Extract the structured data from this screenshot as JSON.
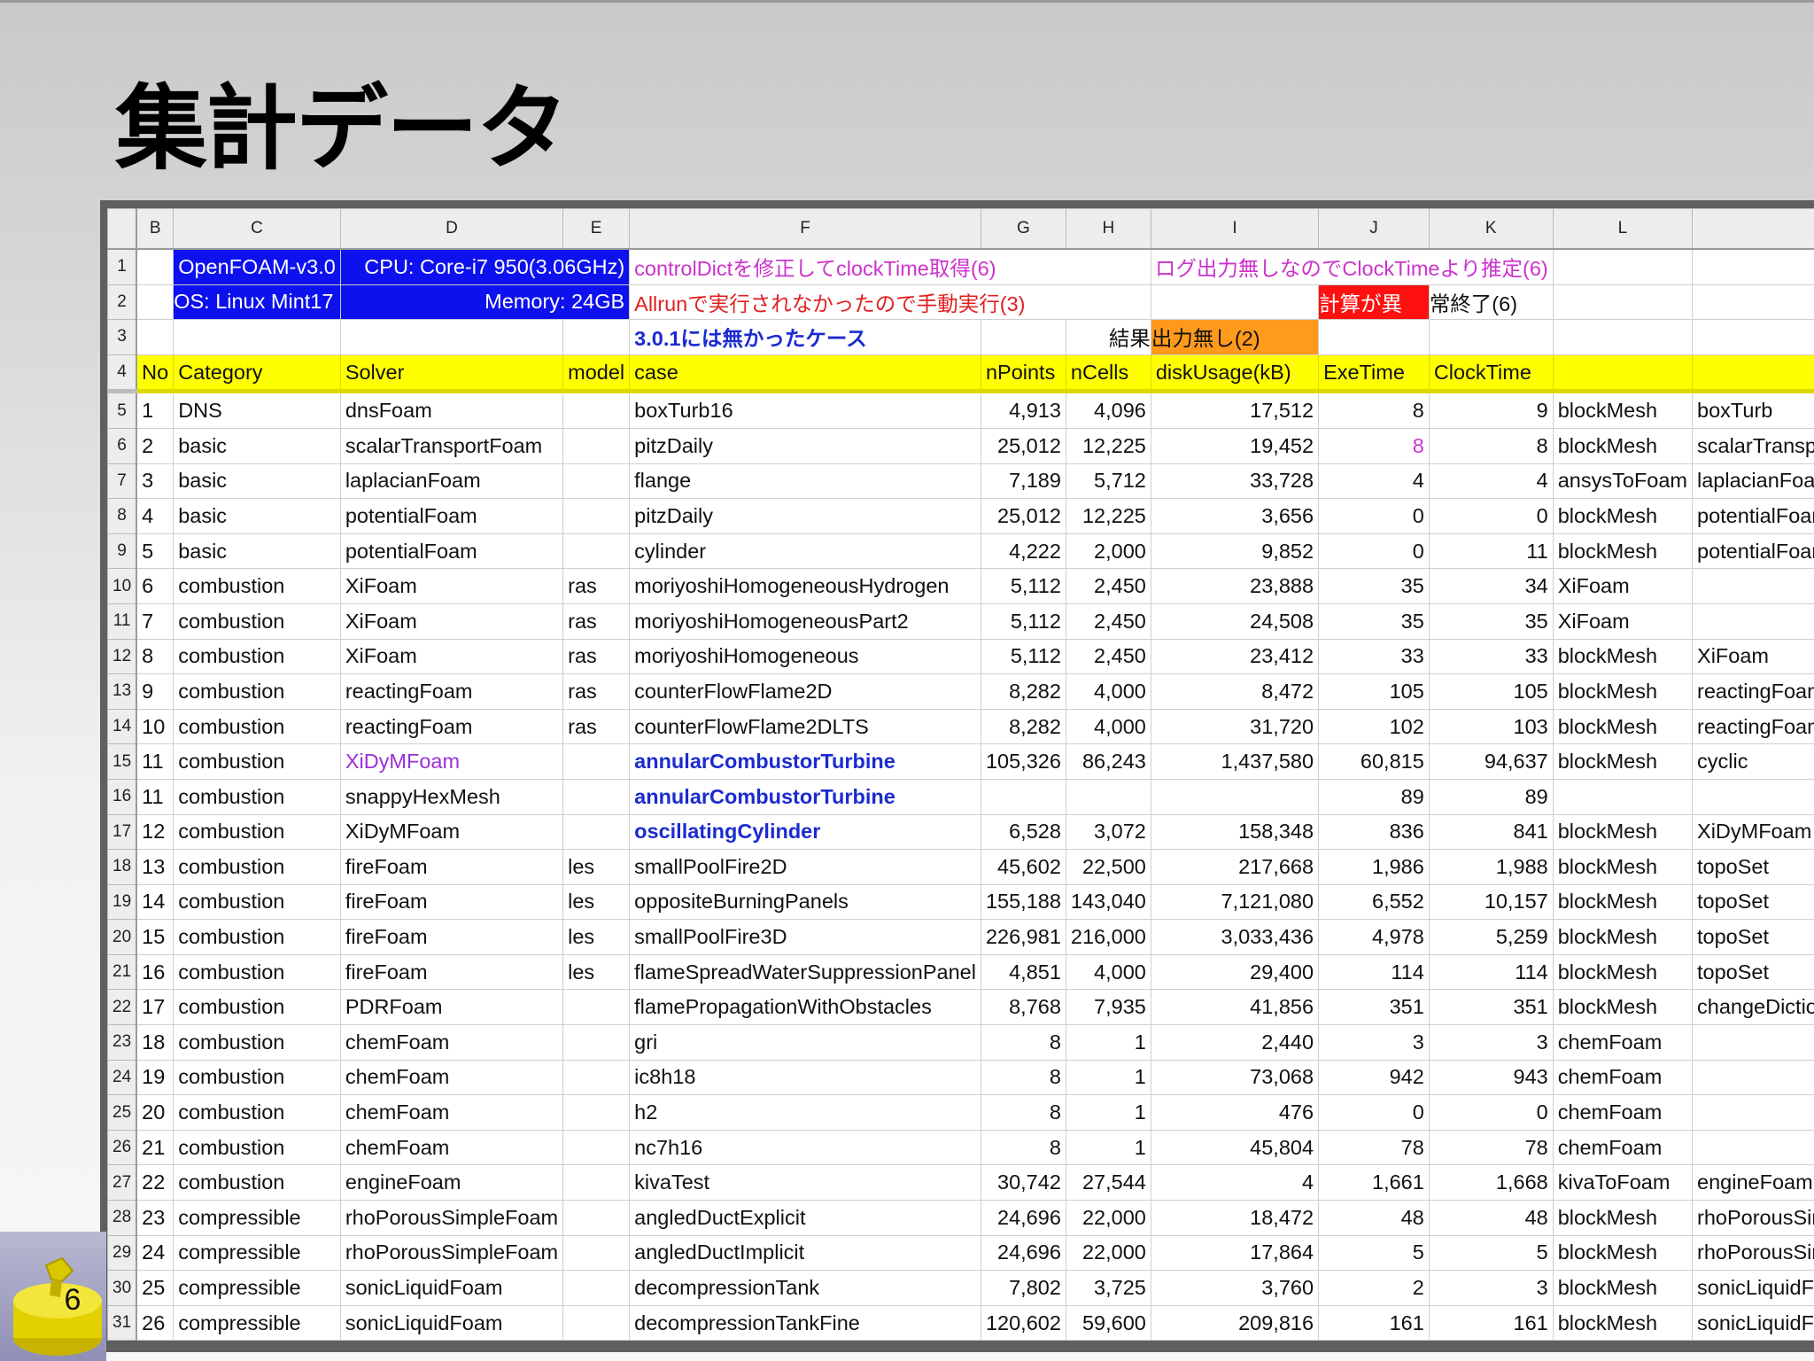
{
  "slide": {
    "title": "集計データ",
    "page_number": "6"
  },
  "column_headers": [
    "B",
    "C",
    "D",
    "E",
    "F",
    "G",
    "H",
    "I",
    "J",
    "K",
    "L",
    ""
  ],
  "top_rows": {
    "r1": {
      "rn": "1",
      "c": "OpenFOAM-v3.0",
      "de": "CPU: Core-i7 950(3.06GHz)",
      "f": "controlDictを修正してclockTime取得(6)",
      "ik": "ログ出力無しなのでClockTimeより推定(6)"
    },
    "r2": {
      "rn": "2",
      "c": "OS: Linux Mint17",
      "de": "Memory: 24GB",
      "f": "Allrunで実行されなかったので手動実行(3)",
      "j": "計算が異",
      "k": "常終了(6)"
    },
    "r3": {
      "rn": "3",
      "f": "3.0.1には無かったケース",
      "h": "結果",
      "i": "出力無し(2)"
    }
  },
  "header_row": {
    "rn": "4",
    "cells": [
      "No",
      "Category",
      "Solver",
      "model",
      "case",
      "nPoints",
      "nCells",
      "diskUsage(kB)",
      "ExeTime",
      "ClockTime",
      "",
      ""
    ]
  },
  "rows": [
    [
      "5",
      "1",
      "DNS",
      "dnsFoam",
      "",
      "boxTurb16",
      "4,913",
      "4,096",
      "17,512",
      "8",
      "9",
      "blockMesh",
      "boxTurb"
    ],
    [
      "6",
      "2",
      "basic",
      "scalarTransportFoam",
      "",
      "pitzDaily",
      "25,012",
      "12,225",
      "19,452",
      "8",
      "8",
      "blockMesh",
      "scalarTransportFoam"
    ],
    [
      "7",
      "3",
      "basic",
      "laplacianFoam",
      "",
      "flange",
      "7,189",
      "5,712",
      "33,728",
      "4",
      "4",
      "ansysToFoam",
      "laplacianFoam"
    ],
    [
      "8",
      "4",
      "basic",
      "potentialFoam",
      "",
      "pitzDaily",
      "25,012",
      "12,225",
      "3,656",
      "0",
      "0",
      "blockMesh",
      "potentialFoam"
    ],
    [
      "9",
      "5",
      "basic",
      "potentialFoam",
      "",
      "cylinder",
      "4,222",
      "2,000",
      "9,852",
      "0",
      "11",
      "blockMesh",
      "potentialFoam"
    ],
    [
      "10",
      "6",
      "combustion",
      "XiFoam",
      "ras",
      "moriyoshiHomogeneousHydrogen",
      "5,112",
      "2,450",
      "23,888",
      "35",
      "34",
      "XiFoam",
      ""
    ],
    [
      "11",
      "7",
      "combustion",
      "XiFoam",
      "ras",
      "moriyoshiHomogeneousPart2",
      "5,112",
      "2,450",
      "24,508",
      "35",
      "35",
      "XiFoam",
      ""
    ],
    [
      "12",
      "8",
      "combustion",
      "XiFoam",
      "ras",
      "moriyoshiHomogeneous",
      "5,112",
      "2,450",
      "23,412",
      "33",
      "33",
      "blockMesh",
      "XiFoam"
    ],
    [
      "13",
      "9",
      "combustion",
      "reactingFoam",
      "ras",
      "counterFlowFlame2D",
      "8,282",
      "4,000",
      "8,472",
      "105",
      "105",
      "blockMesh",
      "reactingFoam"
    ],
    [
      "14",
      "10",
      "combustion",
      "reactingFoam",
      "ras",
      "counterFlowFlame2DLTS",
      "8,282",
      "4,000",
      "31,720",
      "102",
      "103",
      "blockMesh",
      "reactingFoam"
    ],
    [
      "15",
      "11",
      "combustion",
      "XiDyMFoam",
      "",
      "annularCombustorTurbine",
      "105,326",
      "86,243",
      "1,437,580",
      "60,815",
      "94,637",
      "blockMesh",
      "cyclic"
    ],
    [
      "16",
      "11",
      "combustion",
      "snappyHexMesh",
      "",
      "annularCombustorTurbine",
      "",
      "",
      "",
      "89",
      "89",
      "",
      ""
    ],
    [
      "17",
      "12",
      "combustion",
      "XiDyMFoam",
      "",
      "oscillatingCylinder",
      "6,528",
      "3,072",
      "158,348",
      "836",
      "841",
      "blockMesh",
      "XiDyMFoam"
    ],
    [
      "18",
      "13",
      "combustion",
      "fireFoam",
      "les",
      "smallPoolFire2D",
      "45,602",
      "22,500",
      "217,668",
      "1,986",
      "1,988",
      "blockMesh",
      "topoSet"
    ],
    [
      "19",
      "14",
      "combustion",
      "fireFoam",
      "les",
      "oppositeBurningPanels",
      "155,188",
      "143,040",
      "7,121,080",
      "6,552",
      "10,157",
      "blockMesh",
      "topoSet"
    ],
    [
      "20",
      "15",
      "combustion",
      "fireFoam",
      "les",
      "smallPoolFire3D",
      "226,981",
      "216,000",
      "3,033,436",
      "4,978",
      "5,259",
      "blockMesh",
      "topoSet"
    ],
    [
      "21",
      "16",
      "combustion",
      "fireFoam",
      "les",
      "flameSpreadWaterSuppressionPanel",
      "4,851",
      "4,000",
      "29,400",
      "114",
      "114",
      "blockMesh",
      "topoSet"
    ],
    [
      "22",
      "17",
      "combustion",
      "PDRFoam",
      "",
      "flamePropagationWithObstacles",
      "8,768",
      "7,935",
      "41,856",
      "351",
      "351",
      "blockMesh",
      "changeDictionary"
    ],
    [
      "23",
      "18",
      "combustion",
      "chemFoam",
      "",
      "gri",
      "8",
      "1",
      "2,440",
      "3",
      "3",
      "chemFoam",
      ""
    ],
    [
      "24",
      "19",
      "combustion",
      "chemFoam",
      "",
      "ic8h18",
      "8",
      "1",
      "73,068",
      "942",
      "943",
      "chemFoam",
      ""
    ],
    [
      "25",
      "20",
      "combustion",
      "chemFoam",
      "",
      "h2",
      "8",
      "1",
      "476",
      "0",
      "0",
      "chemFoam",
      ""
    ],
    [
      "26",
      "21",
      "combustion",
      "chemFoam",
      "",
      "nc7h16",
      "8",
      "1",
      "45,804",
      "78",
      "78",
      "chemFoam",
      ""
    ],
    [
      "27",
      "22",
      "combustion",
      "engineFoam",
      "",
      "kivaTest",
      "30,742",
      "27,544",
      "4",
      "1,661",
      "1,668",
      "kivaToFoam",
      "engineFoam"
    ],
    [
      "28",
      "23",
      "compressible",
      "rhoPorousSimpleFoam",
      "",
      "angledDuctExplicit",
      "24,696",
      "22,000",
      "18,472",
      "48",
      "48",
      "blockMesh",
      "rhoPorousSimpleFoam"
    ],
    [
      "29",
      "24",
      "compressible",
      "rhoPorousSimpleFoam",
      "",
      "angledDuctImplicit",
      "24,696",
      "22,000",
      "17,864",
      "5",
      "5",
      "blockMesh",
      "rhoPorousSimpleFoam"
    ],
    [
      "30",
      "25",
      "compressible",
      "sonicLiquidFoam",
      "",
      "decompressionTank",
      "7,802",
      "3,725",
      "3,760",
      "2",
      "3",
      "blockMesh",
      "sonicLiquidFoam"
    ],
    [
      "31",
      "26",
      "compressible",
      "sonicLiquidFoam",
      "",
      "decompressionTankFine",
      "120,602",
      "59,600",
      "209,816",
      "161",
      "161",
      "blockMesh",
      "sonicLiquidFoam"
    ]
  ],
  "colors": {
    "blue_fill": "#0d11ee",
    "header_yellow": "#ffff00",
    "note_magenta": "#cc33cc",
    "note_red": "#e02020",
    "error_red_fill": "#ff1010",
    "no_output_orange": "#ff9a1c",
    "new_case_blue": "#1b2bd0",
    "solver_purple": "#9b30d9"
  }
}
